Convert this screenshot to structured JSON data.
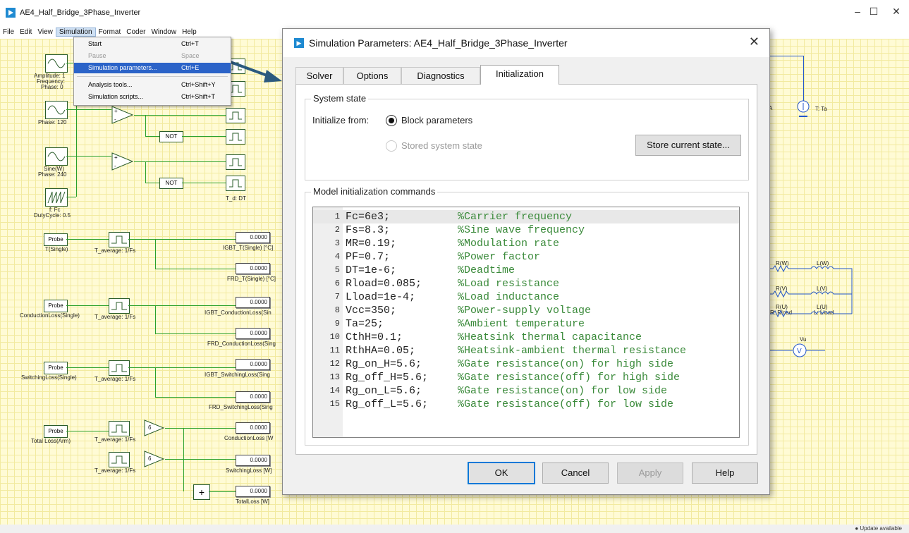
{
  "app": {
    "title": "AE4_Half_Bridge_3Phase_Inverter",
    "minimize": "–",
    "maximize": "☐",
    "close": "✕"
  },
  "menubar": [
    "File",
    "Edit",
    "View",
    "Simulation",
    "Format",
    "Coder",
    "Window",
    "Help"
  ],
  "sim_menu": {
    "items": [
      {
        "label": "Start",
        "shortcut": "Ctrl+T",
        "state": "normal"
      },
      {
        "label": "Pause",
        "shortcut": "Space",
        "state": "disabled"
      },
      {
        "label": "Simulation parameters...",
        "shortcut": "Ctrl+E",
        "state": "highlighted"
      },
      {
        "label": "Analysis tools...",
        "shortcut": "Ctrl+Shift+Y",
        "state": "normal"
      },
      {
        "label": "Simulation scripts...",
        "shortcut": "Ctrl+Shift+T",
        "state": "normal"
      }
    ]
  },
  "canvas": {
    "labels": {
      "amp": "Amplitude: 1",
      "freq": "Frequency:",
      "phase0": "Phase: 0",
      "phase120": "Phase: 120",
      "sine": "Sine(W)",
      "phase240": "Phase: 240",
      "fc": "f: Fc",
      "duty": "DutyCycle: 0.5",
      "not1": "NOT",
      "not2": "NOT",
      "td": "T_d: DT",
      "probe": "Probe",
      "probe1": "T(Single)",
      "probe2": "ConductionLoss(Single)",
      "probe3": "SwitchingLoss(Single)",
      "probe4": "Total Loss(Arm)",
      "tavg": "T_average: 1/Fs",
      "out1": "IGBT_T(Single) [°C]",
      "out2": "FRD_T(Single) [°C]",
      "out3": "IGBT_ConductionLoss(Sin",
      "out4": "FRD_ConductionLoss(Sing",
      "out5": "IGBT_SwitchingLoss(Sing",
      "out6": "FRD_SwitchingLoss(Sing",
      "out7": "ConductionLoss [W",
      "out8": "SwitchingLoss [W]",
      "out9": "TotalLoss [W]",
      "display_val": "0.0000",
      "gain": "6",
      "sum": "+",
      "ta": "T: Ta",
      "rw": "R(W)",
      "lw": "L(W)",
      "rv": "R(V)",
      "lv": "L(V)",
      "ru": "R(U)",
      "lu": "L(U)",
      "rload": "R: Rload",
      "lload": "L: Lload",
      "vu": "Vu",
      "va": "A"
    }
  },
  "dialog": {
    "title": "Simulation Parameters: AE4_Half_Bridge_3Phase_Inverter",
    "close": "✕",
    "tabs": [
      "Solver",
      "Options",
      "Diagnostics",
      "Initialization"
    ],
    "active_tab": "Initialization",
    "system_state": {
      "title": "System state",
      "initialize_from": "Initialize from:",
      "option_block": "Block parameters",
      "option_stored": "Stored system state",
      "store_button": "Store current state..."
    },
    "model_init": {
      "title": "Model initialization commands",
      "lines": [
        {
          "n": "1",
          "code": "Fc=6e3;",
          "comment": "%Carrier frequency"
        },
        {
          "n": "2",
          "code": "Fs=8.3;",
          "comment": "%Sine wave frequency"
        },
        {
          "n": "3",
          "code": "MR=0.19;",
          "comment": "%Modulation rate"
        },
        {
          "n": "4",
          "code": "PF=0.7;",
          "comment": "%Power factor"
        },
        {
          "n": "5",
          "code": "DT=1e-6;",
          "comment": "%Deadtime"
        },
        {
          "n": "6",
          "code": "Rload=0.085;",
          "comment": "%Load resistance"
        },
        {
          "n": "7",
          "code": "Lload=1e-4;",
          "comment": "%Load inductance"
        },
        {
          "n": "8",
          "code": "Vcc=350;",
          "comment": "%Power-supply voltage"
        },
        {
          "n": "9",
          "code": "Ta=25;",
          "comment": "%Ambient temperature"
        },
        {
          "n": "10",
          "code": "CthH=0.1;",
          "comment": "%Heatsink thermal capacitance"
        },
        {
          "n": "11",
          "code": "RthHA=0.05;",
          "comment": "%Heatsink-ambient thermal resistance"
        },
        {
          "n": "12",
          "code": "Rg_on_H=5.6;",
          "comment": "%Gate resistance(on) for high side"
        },
        {
          "n": "13",
          "code": "Rg_off_H=5.6;",
          "comment": "%Gate resistance(off) for high side"
        },
        {
          "n": "14",
          "code": "Rg_on_L=5.6;",
          "comment": "%Gate resistance(on) for low side"
        },
        {
          "n": "15",
          "code": "Rg_off_L=5.6;",
          "comment": "%Gate resistance(off) for low side"
        }
      ]
    },
    "buttons": {
      "ok": "OK",
      "cancel": "Cancel",
      "apply": "Apply",
      "help": "Help"
    }
  },
  "status": {
    "update": "Update available"
  }
}
